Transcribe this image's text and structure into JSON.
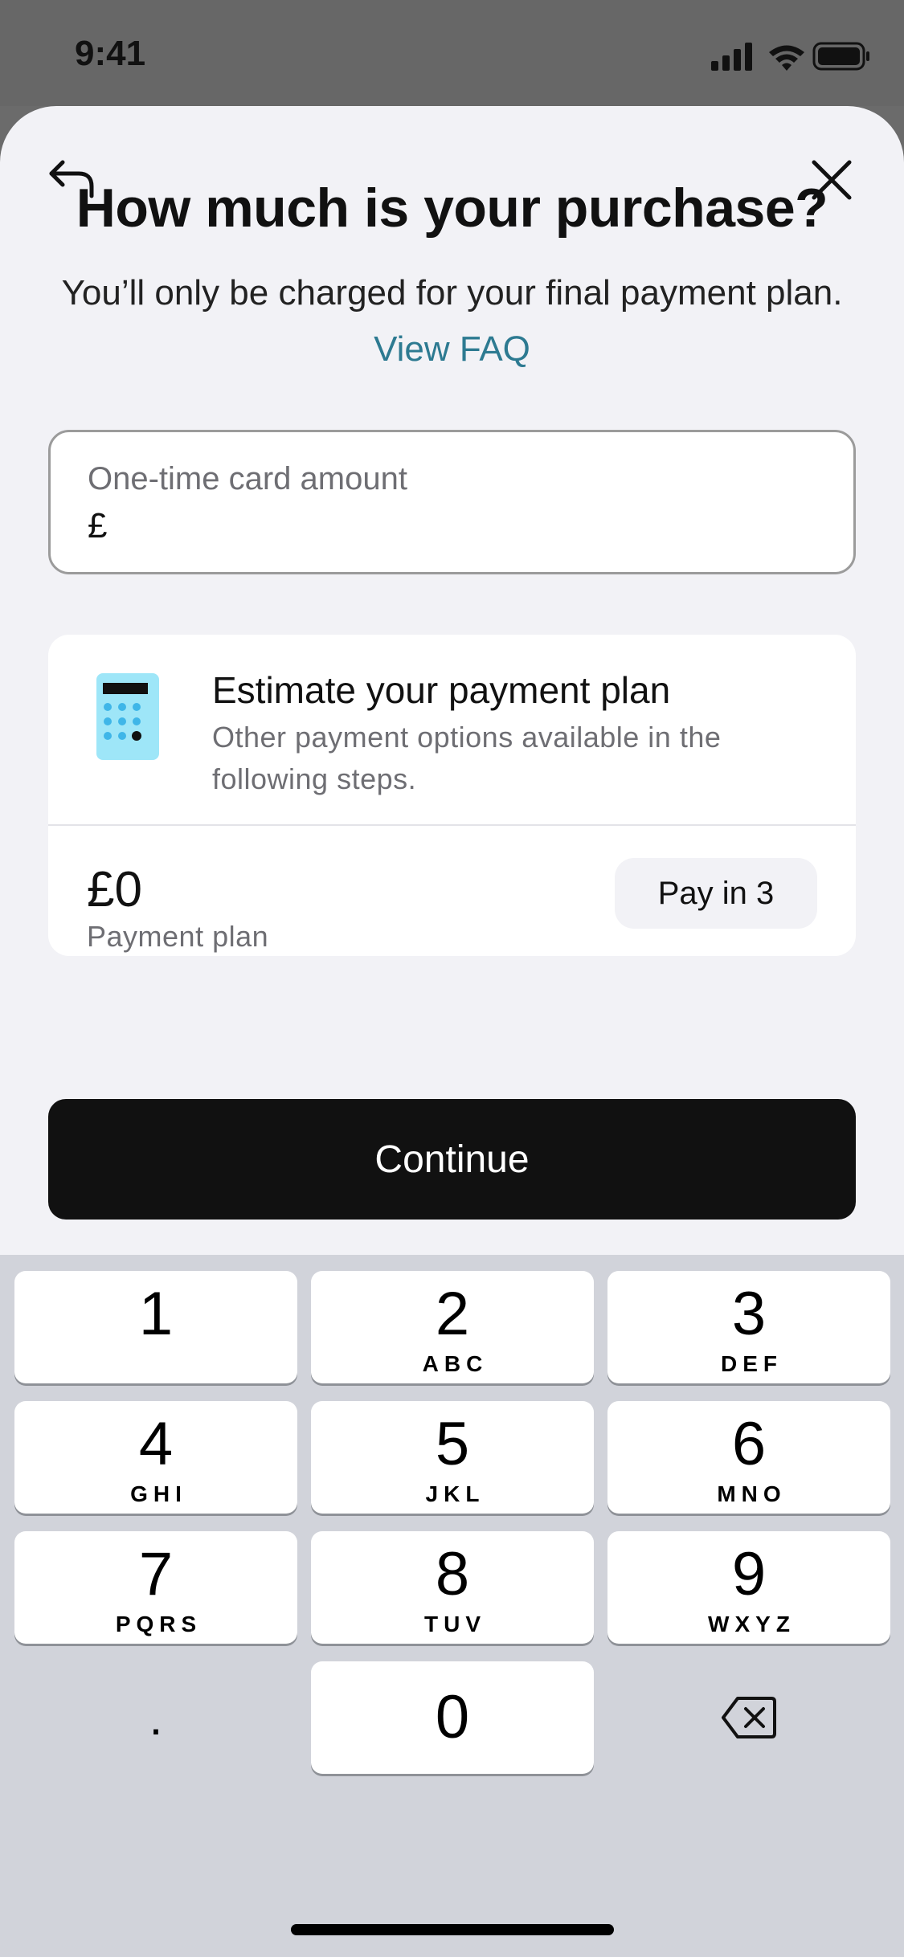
{
  "status_bar": {
    "time": "9:41"
  },
  "header": {
    "back_icon": "back-arrow-icon",
    "close_icon": "close-icon"
  },
  "title": "How much is your purchase?",
  "subtitle": {
    "text": "You’ll only be charged for your final payment plan.",
    "link": "View FAQ"
  },
  "amount_field": {
    "label": "One-time card amount",
    "currency_prefix": "£",
    "value": ""
  },
  "plan_card": {
    "icon": "calculator-icon",
    "heading": "Estimate your payment plan",
    "description": "Other payment options available in the following steps.",
    "amount": "£0",
    "amount_caption": "Payment plan",
    "option_label": "Pay in 3"
  },
  "continue_label": "Continue",
  "keypad": {
    "keys": [
      {
        "num": "1",
        "letters": ""
      },
      {
        "num": "2",
        "letters": "ABC"
      },
      {
        "num": "3",
        "letters": "DEF"
      },
      {
        "num": "4",
        "letters": "GHI"
      },
      {
        "num": "5",
        "letters": "JKL"
      },
      {
        "num": "6",
        "letters": "MNO"
      },
      {
        "num": "7",
        "letters": "PQRS"
      },
      {
        "num": "8",
        "letters": "TUV"
      },
      {
        "num": "9",
        "letters": "WXYZ"
      },
      {
        "num": "0",
        "letters": ""
      }
    ],
    "decimal": ".",
    "delete_icon": "backspace-icon"
  },
  "colors": {
    "accent_link": "#2d7a91",
    "primary_button": "#111111",
    "sheet_bg": "#f2f2f6",
    "keyboard_bg": "#d1d3da"
  }
}
